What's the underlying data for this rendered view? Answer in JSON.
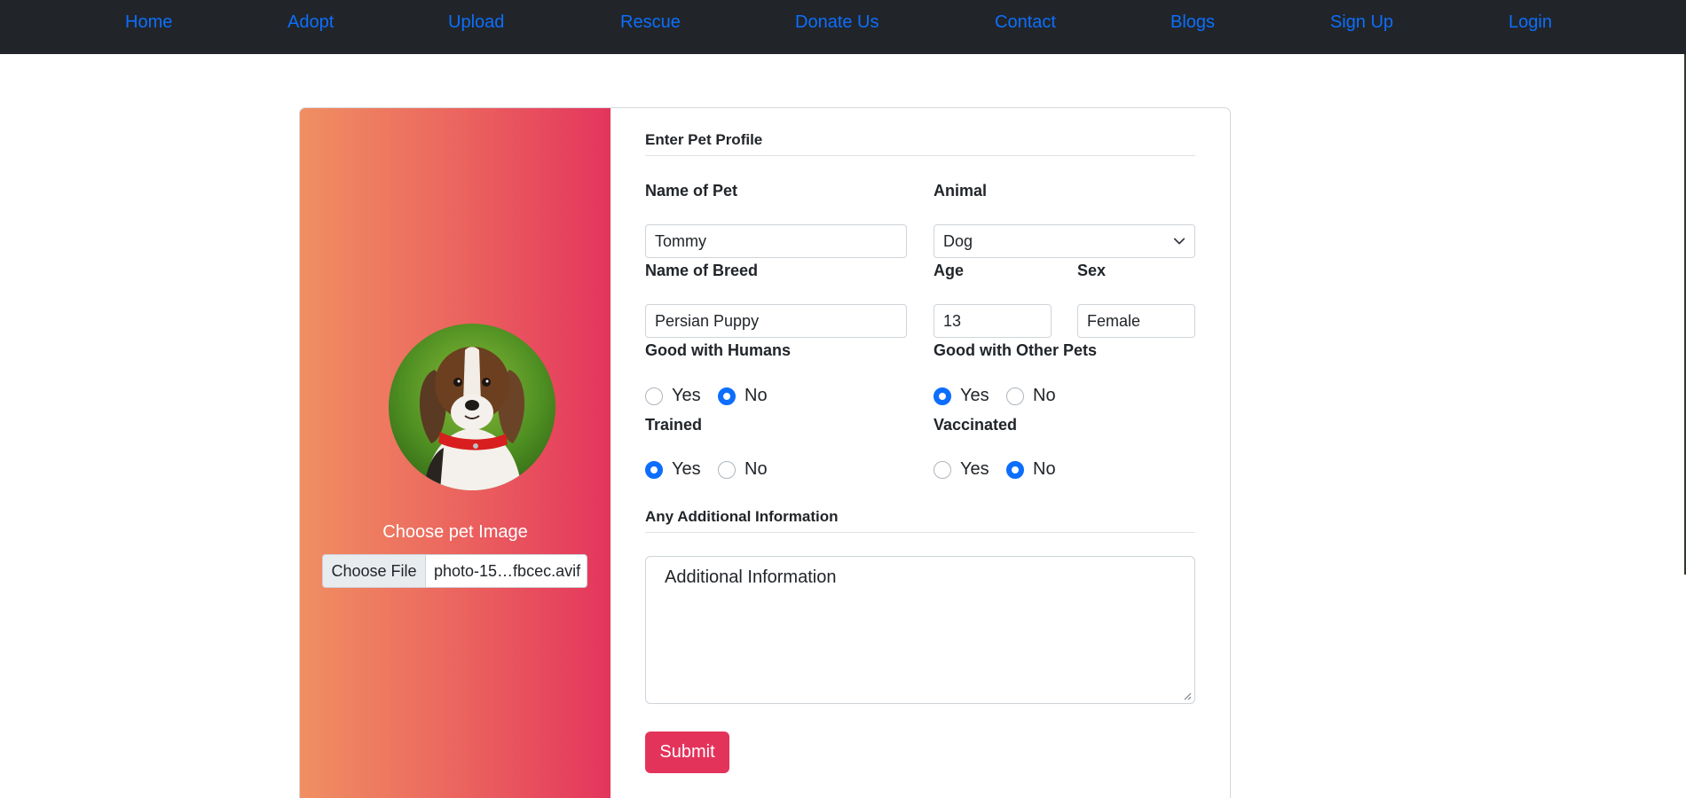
{
  "nav": {
    "home": "Home",
    "adopt": "Adopt",
    "upload": "Upload",
    "rescue": "Rescue",
    "donate": "Donate Us",
    "contact": "Contact",
    "blogs": "Blogs",
    "signup": "Sign Up",
    "login": "Login"
  },
  "colors": {
    "nav_bg": "#212529",
    "link": "#0d6efd",
    "gradient_start": "#f08f62",
    "gradient_end": "#e4355d",
    "submit": "#e4335b"
  },
  "left": {
    "choose_label": "Choose pet Image",
    "file_button": "Choose File",
    "file_name": "photo-15…fbcec.avif",
    "photo": "beagle-dog-photo"
  },
  "form": {
    "title": "Enter Pet Profile",
    "name_label": "Name of Pet",
    "name_value": "Tommy",
    "animal_label": "Animal",
    "animal_value": "Dog",
    "breed_label": "Name of Breed",
    "breed_value": "Persian Puppy",
    "age_label": "Age",
    "age_value": "13",
    "sex_label": "Sex",
    "sex_value": "Female",
    "humans_label": "Good with Humans",
    "humans_yes": "Yes",
    "humans_no": "No",
    "humans_selected": "No",
    "pets_label": "Good with Other Pets",
    "pets_yes": "Yes",
    "pets_no": "No",
    "pets_selected": "Yes",
    "trained_label": "Trained",
    "trained_yes": "Yes",
    "trained_no": "No",
    "trained_selected": "Yes",
    "vaccinated_label": "Vaccinated",
    "vaccinated_yes": "Yes",
    "vaccinated_no": "No",
    "vaccinated_selected": "No",
    "additional_heading": "Any Additional Information",
    "additional_placeholder": "Additional Information",
    "submit_label": "Submit"
  }
}
